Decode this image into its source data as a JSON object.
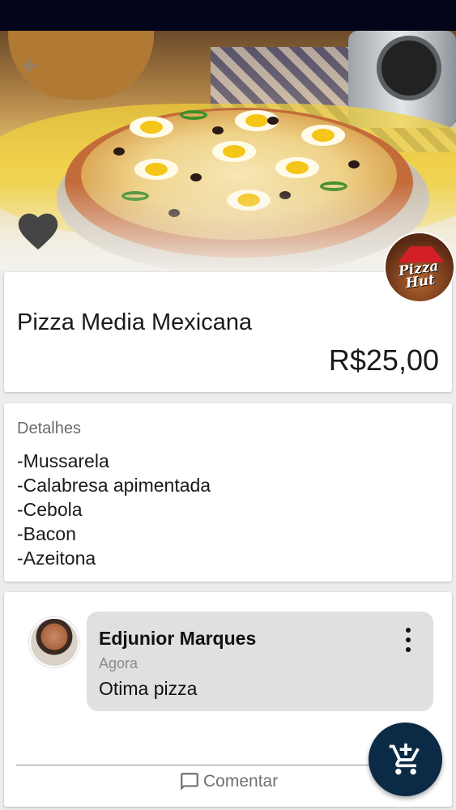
{
  "header": {
    "back_icon": "arrow-left-icon",
    "favorite_icon": "heart-icon"
  },
  "product": {
    "name": "Pizza Media Mexicana",
    "price": "R$25,00",
    "store_logo": {
      "line1": "Pizza",
      "line2": "Hut"
    }
  },
  "details": {
    "title": "Detalhes",
    "items": [
      "-Mussarela",
      "-Calabresa apimentada",
      "-Cebola",
      "-Bacon",
      "-Azeitona"
    ]
  },
  "comments": {
    "items": [
      {
        "author": "Edjunior Marques",
        "time": "Agora",
        "text": "Otima pizza"
      }
    ],
    "action_label": "Comentar",
    "action_icon": "comment-icon"
  },
  "fab": {
    "icon": "add-to-cart-icon"
  },
  "colors": {
    "status_bar": "#03051a",
    "fab_background": "#0b2a45",
    "comment_bubble": "#e0e0e0",
    "brand_red": "#d41f26"
  }
}
